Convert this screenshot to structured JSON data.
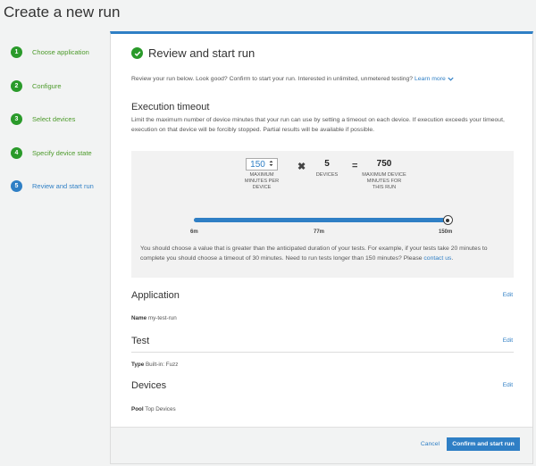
{
  "page": {
    "title": "Create a new run"
  },
  "steps": [
    {
      "num": "1",
      "label": "Choose application",
      "state": "done"
    },
    {
      "num": "2",
      "label": "Configure",
      "state": "done"
    },
    {
      "num": "3",
      "label": "Select devices",
      "state": "done"
    },
    {
      "num": "4",
      "label": "Specify device state",
      "state": "done"
    },
    {
      "num": "5",
      "label": "Review and start run",
      "state": "active"
    }
  ],
  "review": {
    "title": "Review and start run",
    "intro": "Review your run below. Look good? Confirm to start your run. Interested in unlimited, unmetered testing?",
    "learn_more": "Learn more"
  },
  "timeout": {
    "title": "Execution timeout",
    "description": "Limit the maximum number of device minutes that your run can use by setting a timeout on each device. If execution exceeds your timeout, execution on that device will be forcibly stopped. Partial results will be available if possible.",
    "minutes_value": "150",
    "minutes_label": "Maximum minutes per device",
    "multiply": "✖",
    "devices_value": "5",
    "devices_label": "Devices",
    "equals": "=",
    "total_value": "750",
    "total_label": "Maximum device minutes for this run",
    "slider": {
      "min_label": "6m",
      "mid_label": "77m",
      "max_label": "150m",
      "fraction": 1.0
    },
    "note": "You should choose a value that is greater than the anticipated duration of your tests. For example, if your tests take 20 minutes to complete you should choose a timeout of 30 minutes. Need to run tests longer than 150 minutes? Please",
    "contact": "contact us",
    "note_end": "."
  },
  "application": {
    "title": "Application",
    "edit": "Edit",
    "key": "Name",
    "value": "my-test-run"
  },
  "test": {
    "title": "Test",
    "edit": "Edit",
    "key": "Type",
    "value": "Built-in: Fuzz"
  },
  "devices": {
    "title": "Devices",
    "edit": "Edit",
    "key": "Pool",
    "value": "Top Devices"
  },
  "footer": {
    "cancel": "Cancel",
    "confirm": "Confirm and start run"
  },
  "colors": {
    "accent": "#2f7fc5",
    "success": "#2a9a2a"
  }
}
